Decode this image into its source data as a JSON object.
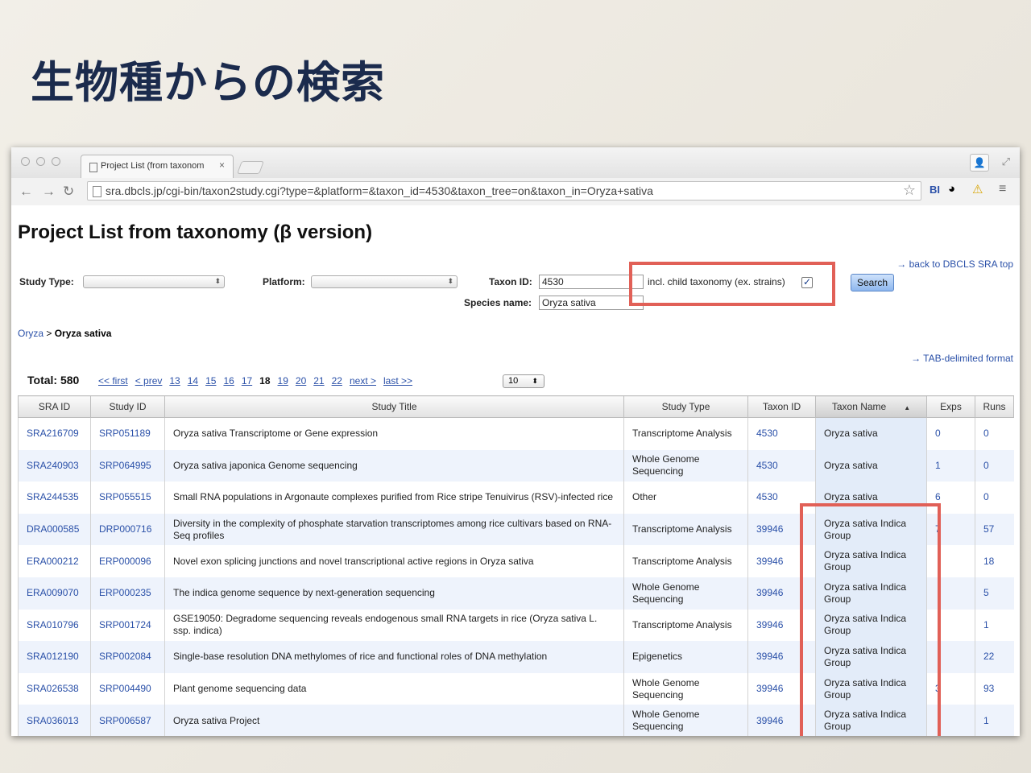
{
  "slide": {
    "title": "生物種からの検索"
  },
  "browser": {
    "tab_title": "Project List (from taxonom",
    "tab_close": "×",
    "url": "sra.dbcls.jp/cgi-bin/taxon2study.cgi?type=&platform=&taxon_id=4530&taxon_tree=on&taxon_in=Oryza+sativa",
    "ext_bi": "BI"
  },
  "page": {
    "title": "Project List from taxonomy (β version)",
    "back_link": "→ back to DBCLS SRA top",
    "study_type_label": "Study Type:",
    "platform_label": "Platform:",
    "taxon_id_label": "Taxon ID:",
    "taxon_id_value": "4530",
    "species_label": "Species name:",
    "species_value": "Oryza sativa",
    "child_label": "incl. child taxonomy (ex. strains)",
    "search_label": "Search",
    "breadcrumb_parent": "Oryza",
    "breadcrumb_sep": ">",
    "breadcrumb_current": "Oryza sativa",
    "tab_delimited": "→ TAB-delimited format",
    "total": "Total: 580",
    "pager": {
      "first": "<< first",
      "prev": "< prev",
      "pages": [
        "13",
        "14",
        "15",
        "16",
        "17",
        "18",
        "19",
        "20",
        "21",
        "22"
      ],
      "current": "18",
      "next": "next >",
      "last": "last >>",
      "per_page": "10"
    }
  },
  "table": {
    "headers": [
      "SRA ID",
      "Study ID",
      "Study Title",
      "Study Type",
      "Taxon ID",
      "Taxon Name",
      "Exps",
      "Runs"
    ],
    "sorted_marker": "▲",
    "rows": [
      [
        "SRA216709",
        "SRP051189",
        "Oryza sativa Transcriptome or Gene expression",
        "Transcriptome Analysis",
        "4530",
        "Oryza sativa",
        "0",
        "0"
      ],
      [
        "SRA240903",
        "SRP064995",
        "Oryza sativa japonica Genome sequencing",
        "Whole Genome Sequencing",
        "4530",
        "Oryza sativa",
        "1",
        "0"
      ],
      [
        "SRA244535",
        "SRP055515",
        "Small RNA populations in Argonaute complexes purified from Rice stripe Tenuivirus (RSV)-infected rice",
        "Other",
        "4530",
        "Oryza sativa",
        "6",
        "0"
      ],
      [
        "DRA000585",
        "DRP000716",
        "Diversity in the complexity of phosphate starvation transcriptomes among rice cultivars based on RNA-Seq profiles",
        "Transcriptome Analysis",
        "39946",
        "Oryza sativa Indica Group",
        "7",
        "57"
      ],
      [
        "ERA000212",
        "ERP000096",
        "Novel exon splicing junctions and novel transcriptional active regions in Oryza sativa",
        "Transcriptome Analysis",
        "39946",
        "Oryza sativa Indica Group",
        "",
        "18"
      ],
      [
        "ERA009070",
        "ERP000235",
        "The indica genome sequence by next-generation sequencing",
        "Whole Genome Sequencing",
        "39946",
        "Oryza sativa Indica Group",
        "",
        "5"
      ],
      [
        "SRA010796",
        "SRP001724",
        "GSE19050: Degradome sequencing reveals endogenous small RNA targets in rice (Oryza sativa L. ssp. indica)",
        "Transcriptome Analysis",
        "39946",
        "Oryza sativa Indica Group",
        "",
        "1"
      ],
      [
        "SRA012190",
        "SRP002084",
        "Single-base resolution DNA methylomes of rice and functional roles of DNA methylation",
        "Epigenetics",
        "39946",
        "Oryza sativa Indica Group",
        "",
        "22"
      ],
      [
        "SRA026538",
        "SRP004490",
        "Plant genome sequencing data",
        "Whole Genome Sequencing",
        "39946",
        "Oryza sativa Indica Group",
        "3",
        "93"
      ],
      [
        "SRA036013",
        "SRP006587",
        "Oryza sativa Project",
        "Whole Genome Sequencing",
        "39946",
        "Oryza sativa Indica Group",
        "",
        "1"
      ]
    ]
  },
  "colors": {
    "highlight": "#e16057",
    "link": "#2a50a8",
    "title": "#1b2b4d"
  }
}
